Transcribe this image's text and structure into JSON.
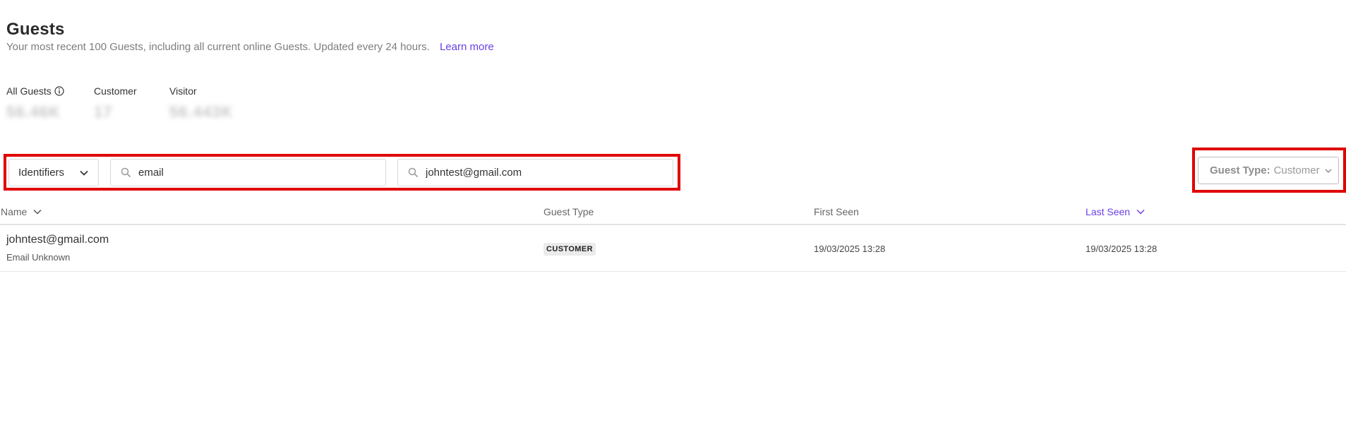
{
  "header": {
    "title": "Guests",
    "subtitle": "Your most recent 100 Guests, including all current online Guests. Updated every 24 hours.",
    "learn_more": "Learn more"
  },
  "stats": [
    {
      "label": "All Guests",
      "value": "56.46K",
      "icon": "info-icon"
    },
    {
      "label": "Customer",
      "value": "17"
    },
    {
      "label": "Visitor",
      "value": "56.443K"
    }
  ],
  "filters": {
    "identifier_select": "Identifiers",
    "key_field": {
      "value": "email",
      "icon": "search-icon"
    },
    "value_field": {
      "value": "johntest@gmail.com",
      "icon": "search-icon"
    },
    "guest_type": {
      "label": "Guest Type:",
      "value": "Customer"
    }
  },
  "table": {
    "columns": [
      {
        "label": "Name",
        "sortable": true,
        "active": false
      },
      {
        "label": "Guest Type",
        "sortable": false,
        "active": false
      },
      {
        "label": "First Seen",
        "sortable": false,
        "active": false
      },
      {
        "label": "Last Seen",
        "sortable": true,
        "active": true
      }
    ],
    "rows": [
      {
        "name": "johntest@gmail.com",
        "sub": "Email Unknown",
        "guest_type": "CUSTOMER",
        "first_seen": "19/03/2025 13:28",
        "last_seen": "19/03/2025 13:28"
      }
    ]
  },
  "colors": {
    "accent": "#6b3fe6",
    "highlight": "#e00000",
    "muted_text": "#7d7d7d"
  }
}
